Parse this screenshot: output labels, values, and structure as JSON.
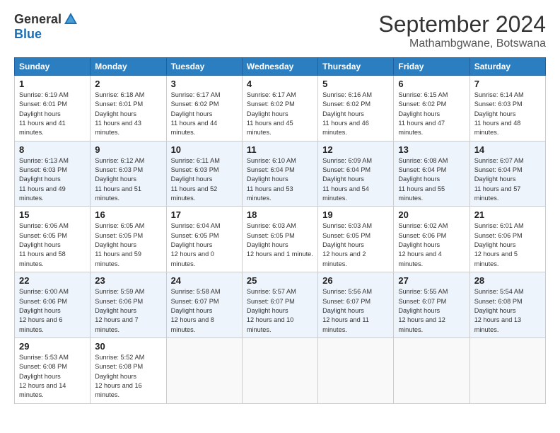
{
  "header": {
    "logo_general": "General",
    "logo_blue": "Blue",
    "month": "September 2024",
    "location": "Mathambgwane, Botswana"
  },
  "weekdays": [
    "Sunday",
    "Monday",
    "Tuesday",
    "Wednesday",
    "Thursday",
    "Friday",
    "Saturday"
  ],
  "weeks": [
    [
      {
        "day": 1,
        "sunrise": "6:19 AM",
        "sunset": "6:01 PM",
        "daylight": "11 hours and 41 minutes."
      },
      {
        "day": 2,
        "sunrise": "6:18 AM",
        "sunset": "6:01 PM",
        "daylight": "11 hours and 43 minutes."
      },
      {
        "day": 3,
        "sunrise": "6:17 AM",
        "sunset": "6:02 PM",
        "daylight": "11 hours and 44 minutes."
      },
      {
        "day": 4,
        "sunrise": "6:17 AM",
        "sunset": "6:02 PM",
        "daylight": "11 hours and 45 minutes."
      },
      {
        "day": 5,
        "sunrise": "6:16 AM",
        "sunset": "6:02 PM",
        "daylight": "11 hours and 46 minutes."
      },
      {
        "day": 6,
        "sunrise": "6:15 AM",
        "sunset": "6:02 PM",
        "daylight": "11 hours and 47 minutes."
      },
      {
        "day": 7,
        "sunrise": "6:14 AM",
        "sunset": "6:03 PM",
        "daylight": "11 hours and 48 minutes."
      }
    ],
    [
      {
        "day": 8,
        "sunrise": "6:13 AM",
        "sunset": "6:03 PM",
        "daylight": "11 hours and 49 minutes."
      },
      {
        "day": 9,
        "sunrise": "6:12 AM",
        "sunset": "6:03 PM",
        "daylight": "11 hours and 51 minutes."
      },
      {
        "day": 10,
        "sunrise": "6:11 AM",
        "sunset": "6:03 PM",
        "daylight": "11 hours and 52 minutes."
      },
      {
        "day": 11,
        "sunrise": "6:10 AM",
        "sunset": "6:04 PM",
        "daylight": "11 hours and 53 minutes."
      },
      {
        "day": 12,
        "sunrise": "6:09 AM",
        "sunset": "6:04 PM",
        "daylight": "11 hours and 54 minutes."
      },
      {
        "day": 13,
        "sunrise": "6:08 AM",
        "sunset": "6:04 PM",
        "daylight": "11 hours and 55 minutes."
      },
      {
        "day": 14,
        "sunrise": "6:07 AM",
        "sunset": "6:04 PM",
        "daylight": "11 hours and 57 minutes."
      }
    ],
    [
      {
        "day": 15,
        "sunrise": "6:06 AM",
        "sunset": "6:05 PM",
        "daylight": "11 hours and 58 minutes."
      },
      {
        "day": 16,
        "sunrise": "6:05 AM",
        "sunset": "6:05 PM",
        "daylight": "11 hours and 59 minutes."
      },
      {
        "day": 17,
        "sunrise": "6:04 AM",
        "sunset": "6:05 PM",
        "daylight": "12 hours and 0 minutes."
      },
      {
        "day": 18,
        "sunrise": "6:03 AM",
        "sunset": "6:05 PM",
        "daylight": "12 hours and 1 minute."
      },
      {
        "day": 19,
        "sunrise": "6:03 AM",
        "sunset": "6:05 PM",
        "daylight": "12 hours and 2 minutes."
      },
      {
        "day": 20,
        "sunrise": "6:02 AM",
        "sunset": "6:06 PM",
        "daylight": "12 hours and 4 minutes."
      },
      {
        "day": 21,
        "sunrise": "6:01 AM",
        "sunset": "6:06 PM",
        "daylight": "12 hours and 5 minutes."
      }
    ],
    [
      {
        "day": 22,
        "sunrise": "6:00 AM",
        "sunset": "6:06 PM",
        "daylight": "12 hours and 6 minutes."
      },
      {
        "day": 23,
        "sunrise": "5:59 AM",
        "sunset": "6:06 PM",
        "daylight": "12 hours and 7 minutes."
      },
      {
        "day": 24,
        "sunrise": "5:58 AM",
        "sunset": "6:07 PM",
        "daylight": "12 hours and 8 minutes."
      },
      {
        "day": 25,
        "sunrise": "5:57 AM",
        "sunset": "6:07 PM",
        "daylight": "12 hours and 10 minutes."
      },
      {
        "day": 26,
        "sunrise": "5:56 AM",
        "sunset": "6:07 PM",
        "daylight": "12 hours and 11 minutes."
      },
      {
        "day": 27,
        "sunrise": "5:55 AM",
        "sunset": "6:07 PM",
        "daylight": "12 hours and 12 minutes."
      },
      {
        "day": 28,
        "sunrise": "5:54 AM",
        "sunset": "6:08 PM",
        "daylight": "12 hours and 13 minutes."
      }
    ],
    [
      {
        "day": 29,
        "sunrise": "5:53 AM",
        "sunset": "6:08 PM",
        "daylight": "12 hours and 14 minutes."
      },
      {
        "day": 30,
        "sunrise": "5:52 AM",
        "sunset": "6:08 PM",
        "daylight": "12 hours and 16 minutes."
      },
      null,
      null,
      null,
      null,
      null
    ]
  ]
}
